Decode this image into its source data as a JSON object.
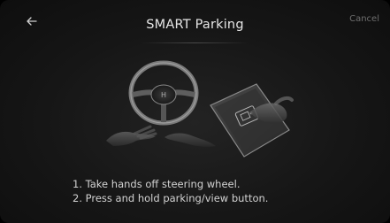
{
  "header": {
    "title": "SMART Parking",
    "cancel_label": "Cancel",
    "back_icon": "arrow-left-icon"
  },
  "illustration": {
    "left_icon": "steering-wheel-hands-off-icon",
    "right_icon": "parking-view-button-press-icon"
  },
  "instructions": {
    "steps": [
      "1. Take hands off steering wheel.",
      "2. Press and hold parking/view button."
    ]
  },
  "colors": {
    "background": "#161616",
    "text": "#d8d8d8",
    "cancel": "#6e6e6e"
  }
}
